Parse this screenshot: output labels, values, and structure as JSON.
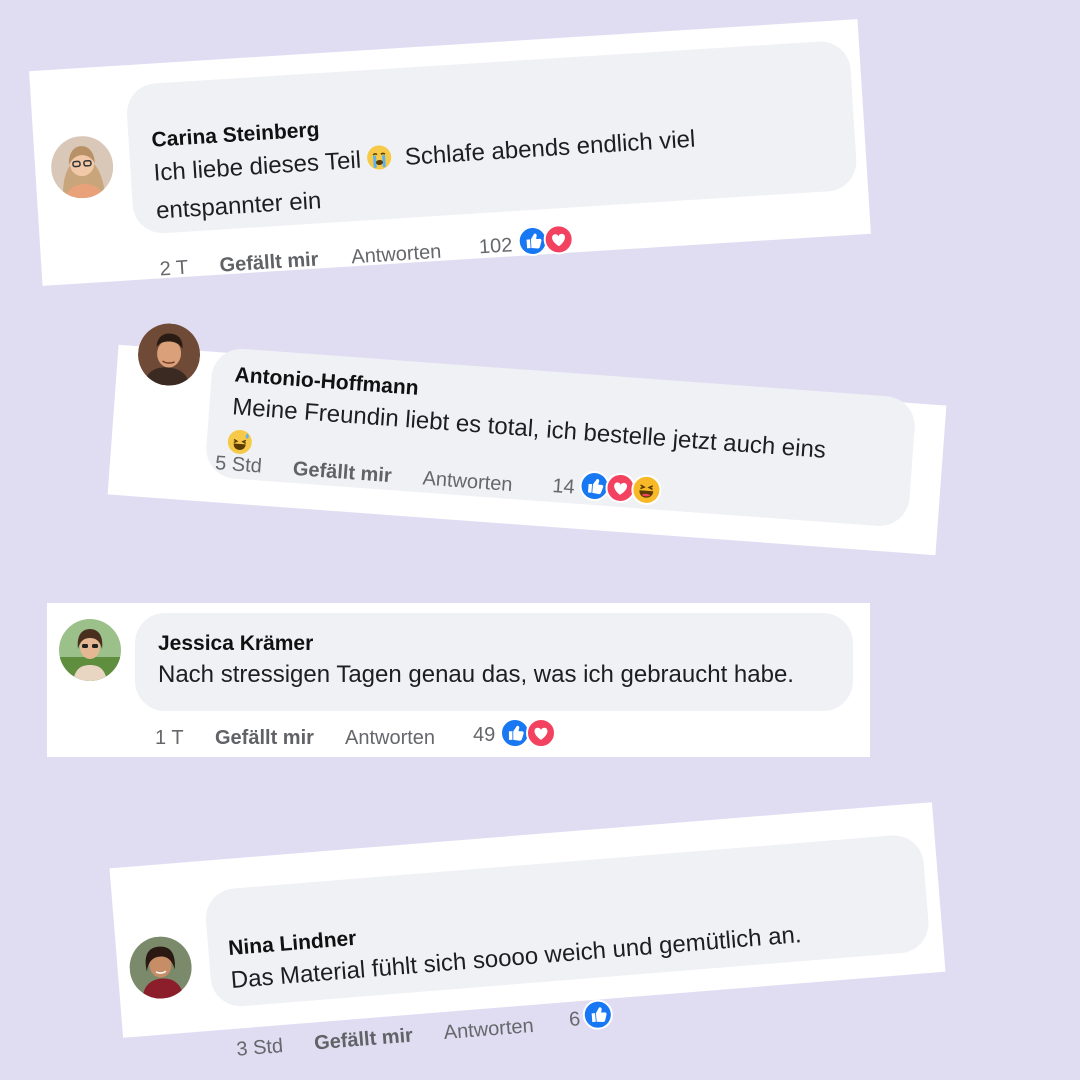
{
  "comments": [
    {
      "name": "Carina Steinberg",
      "text_line1": "Ich liebe dieses Teil",
      "text_line1_after_emoji": "Schlafe abends endlich viel",
      "text_line2": "entspannter ein",
      "emoji": "crying-emoji",
      "time": "2 T",
      "like_label": "Gefällt mir",
      "reply_label": "Antworten",
      "reaction_count": "102",
      "reactions": [
        "like",
        "love"
      ]
    },
    {
      "name": "Antonio-Hoffmann",
      "text_line1": "Meine Freundin liebt es total, ich bestelle jetzt auch eins",
      "emoji": "sweat-smile-emoji",
      "time": "5 Std",
      "like_label": "Gefällt mir",
      "reply_label": "Antworten",
      "reaction_count": "14",
      "reactions": [
        "like",
        "love",
        "haha"
      ]
    },
    {
      "name": "Jessica Krämer",
      "text_line1": "Nach stressigen Tagen genau das, was ich gebraucht habe.",
      "time": "1 T",
      "like_label": "Gefällt mir",
      "reply_label": "Antworten",
      "reaction_count": "49",
      "reactions": [
        "like",
        "love"
      ]
    },
    {
      "name": "Nina Lindner",
      "text_line1": "Das Material fühlt sich soooo weich und gemütlich an.",
      "time": "3 Std",
      "like_label": "Gefällt mir",
      "reply_label": "Antworten",
      "reaction_count": "6",
      "reactions": [
        "like"
      ]
    }
  ],
  "colors": {
    "background": "#e0ddf3",
    "bubble": "#eff1f5",
    "like_blue": "#1877f2",
    "love_red": "#f3425f",
    "haha_yellow": "#f7b928"
  }
}
